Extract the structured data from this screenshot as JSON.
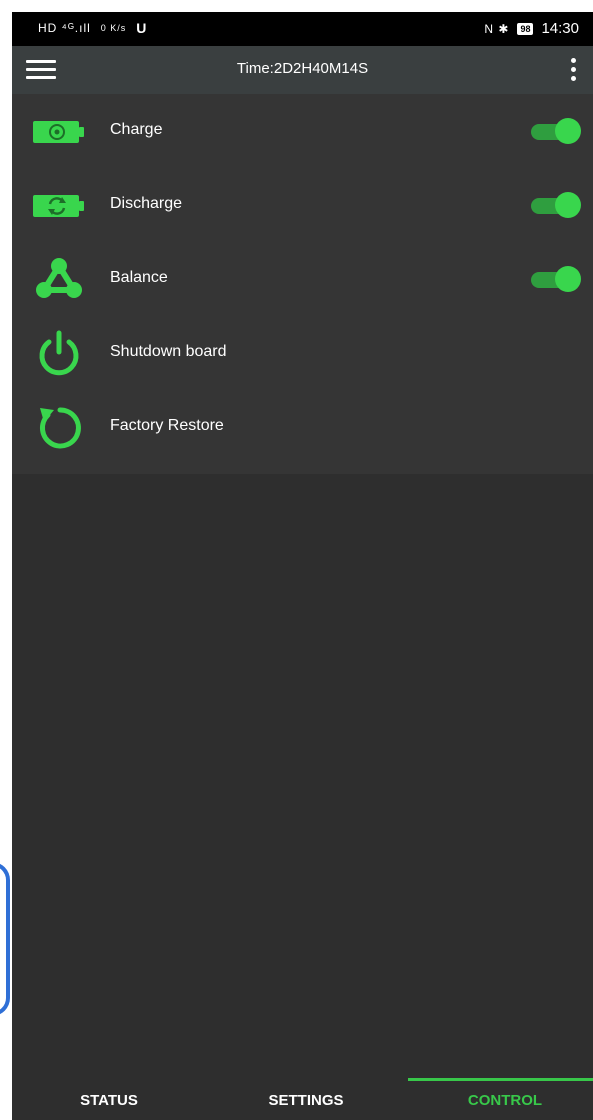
{
  "status_bar": {
    "left_glyphs": "HD ⁴ᴳ.ıll",
    "net_speed": "0 K/s",
    "right_glyphs": "N ✱",
    "battery": "98",
    "time": "14:30"
  },
  "app_bar": {
    "title": "Time:2D2H40M14S"
  },
  "controls": [
    {
      "label": "Charge",
      "icon": "battery-charge-icon",
      "toggle": true
    },
    {
      "label": "Discharge",
      "icon": "battery-discharge-icon",
      "toggle": true
    },
    {
      "label": "Balance",
      "icon": "balance-network-icon",
      "toggle": true
    },
    {
      "label": "Shutdown board",
      "icon": "power-icon",
      "toggle": null
    },
    {
      "label": "Factory Restore",
      "icon": "restore-icon",
      "toggle": null
    }
  ],
  "tabs": [
    {
      "label": "STATUS",
      "active": false
    },
    {
      "label": "SETTINGS",
      "active": false
    },
    {
      "label": "CONTROL",
      "active": true
    }
  ],
  "colors": {
    "accent": "#39d64d",
    "toggle_track": "#2f9e3f",
    "background": "#2e2e2e",
    "list_background": "#353535",
    "app_bar": "#3a3f40"
  }
}
